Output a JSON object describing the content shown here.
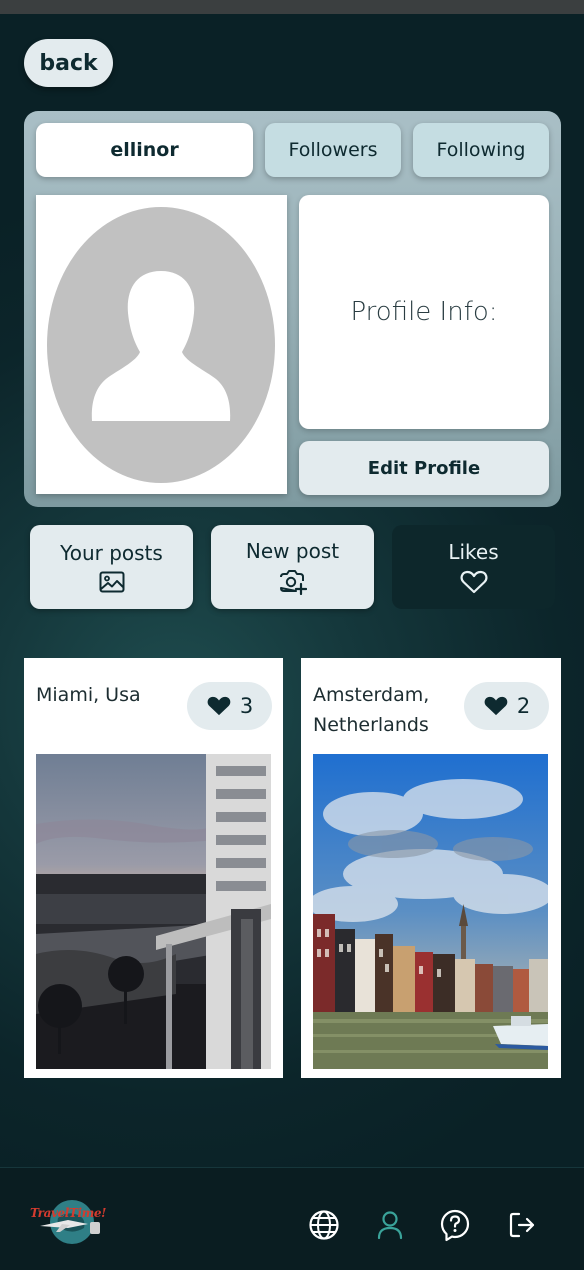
{
  "header": {
    "back_label": "back"
  },
  "profile": {
    "username": "ellinor",
    "tabs": {
      "followers": "Followers",
      "following": "Following"
    },
    "info_label": "Profile Info:",
    "edit_label": "Edit Profile"
  },
  "actions": {
    "your_posts": {
      "label": "Your posts",
      "icon": "image-icon"
    },
    "new_post": {
      "label": "New post",
      "icon": "camera-plus-icon"
    },
    "likes": {
      "label": "Likes",
      "icon": "heart-outline-icon",
      "active": true
    }
  },
  "posts": [
    {
      "location": "Miami, Usa",
      "likes": "3",
      "photo": "miami-balcony-sunset"
    },
    {
      "location": "Amsterdam, Netherlands",
      "likes": "2",
      "photo": "amsterdam-canal-houses"
    }
  ],
  "footer": {
    "logo_text": "TravelTime!",
    "nav": [
      "globe-icon",
      "user-icon",
      "help-icon",
      "logout-icon"
    ]
  },
  "colors": {
    "background": "#0b2329",
    "accent": "#3aa39a",
    "pill": "#e3ebee",
    "tab": "#c5dde2"
  }
}
